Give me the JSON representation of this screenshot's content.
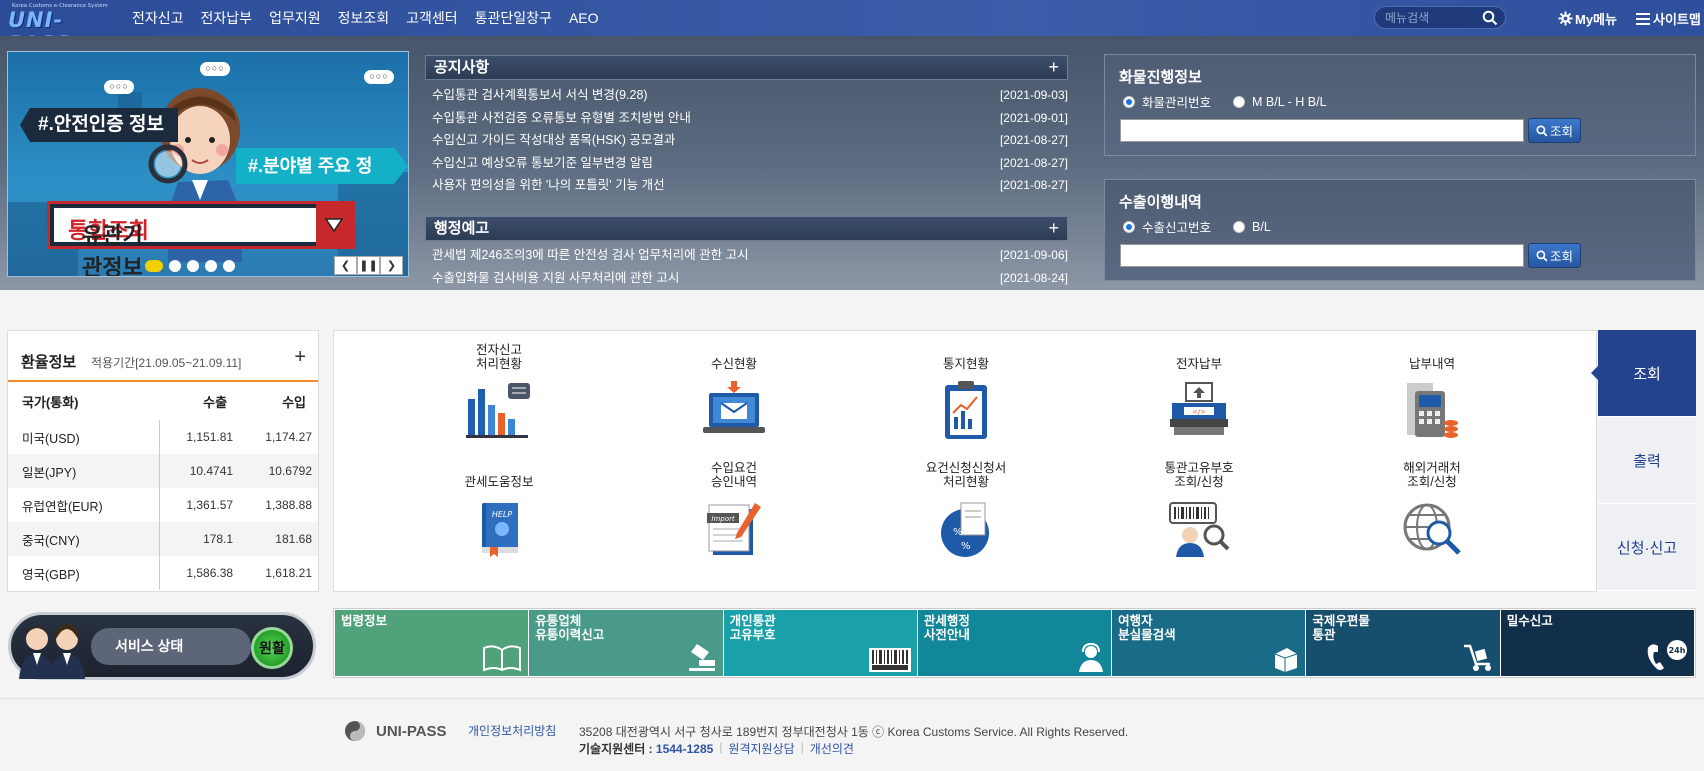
{
  "header": {
    "logo_sub": "Korea Customs e-Clearance System",
    "logo_main": "UNI-PASS",
    "nav": [
      "전자신고",
      "전자납부",
      "업무지원",
      "정보조회",
      "고객센터",
      "통관단일창구",
      "AEO"
    ],
    "search_placeholder": "메뉴검색",
    "my_menu": "My메뉴",
    "sitemap": "사이트맵"
  },
  "banner": {
    "tag_left": "#.안전인증 정보",
    "tag_right": "#.분야별 주요 정보",
    "box_text_1": "유관기관정보 ",
    "box_text_2": "통합조회",
    "dot_count": 5,
    "active_dot": 0
  },
  "notices": {
    "title": "공지사항",
    "items": [
      {
        "text": "수입통관 검사계획통보서 서식 변경(9.28)",
        "date": "[2021-09-03]"
      },
      {
        "text": "수입통관 사전검증 오류통보 유형별 조치방법 안내",
        "date": "[2021-09-01]"
      },
      {
        "text": "수입신고 가이드 작성대상 품목(HSK) 공모결과",
        "date": "[2021-08-27]"
      },
      {
        "text": "수입신고 예상오류 통보기준 일부변경 알림",
        "date": "[2021-08-27]"
      },
      {
        "text": "사용자 편의성을 위한 '나의 포틀릿' 기능 개선",
        "date": "[2021-08-27]"
      }
    ]
  },
  "admin_notice": {
    "title": "행정예고",
    "items": [
      {
        "text": "관세법 제246조의3에 따른 안전성 검사 업무처리에 관한 고시",
        "date": "[2021-09-06]"
      },
      {
        "text": "수출입화물 검사비용 지원 사무처리에 관한 고시",
        "date": "[2021-08-24]"
      }
    ]
  },
  "cargo": {
    "title": "화물진행정보",
    "radio1": "화물관리번호",
    "radio2": "M B/L - H B/L",
    "button": "조회"
  },
  "export": {
    "title": "수출이행내역",
    "radio1": "수출신고번호",
    "radio2": "B/L",
    "button": "조회"
  },
  "fx": {
    "title": "환율정보",
    "period": "적용기간[21.09.05~21.09.11]",
    "headers": [
      "국가(통화)",
      "수출",
      "수입"
    ],
    "rows": [
      {
        "country": "미국(USD)",
        "export": "1,151.81",
        "import": "1,174.27"
      },
      {
        "country": "일본(JPY)",
        "export": "10.4741",
        "import": "10.6792"
      },
      {
        "country": "유럽연합(EUR)",
        "export": "1,361.57",
        "import": "1,388.88"
      },
      {
        "country": "중국(CNY)",
        "export": "178.1",
        "import": "181.68"
      },
      {
        "country": "영국(GBP)",
        "export": "1,586.38",
        "import": "1,618.21"
      }
    ]
  },
  "service_status": {
    "label": "서비스 상태",
    "value": "원활"
  },
  "services": [
    {
      "label": "전자신고\n처리현황",
      "icon": "bar-chart-icon"
    },
    {
      "label": "수신현황",
      "icon": "laptop-mail-icon"
    },
    {
      "label": "통지현황",
      "icon": "clipboard-chart-icon"
    },
    {
      "label": "전자납부",
      "icon": "payment-terminal-icon"
    },
    {
      "label": "납부내역",
      "icon": "receipt-calculator-icon"
    },
    {
      "label": "관세도움정보",
      "icon": "help-book-icon"
    },
    {
      "label": "수입요건\n승인내역",
      "icon": "import-document-icon"
    },
    {
      "label": "요건신청신청서\n처리현황",
      "icon": "percent-document-icon"
    },
    {
      "label": "통관고유부호\n조회/신청",
      "icon": "barcode-search-icon"
    },
    {
      "label": "해외거래처\n조회/신청",
      "icon": "globe-search-icon"
    }
  ],
  "side_tabs": [
    "조회",
    "출력",
    "신청·신고"
  ],
  "quick_links": [
    {
      "label": "법령정보",
      "color": "#4fa27a",
      "icon": "book-icon"
    },
    {
      "label": "유통업체\n유통이력신고",
      "color": "#4a9a8a",
      "icon": "stamp-icon"
    },
    {
      "label": "개인통관\n고유부호",
      "color": "#1aa0a8",
      "icon": "barcode-icon"
    },
    {
      "label": "관세행정\n사전안내",
      "color": "#13879a",
      "icon": "headset-icon"
    },
    {
      "label": "여행자\n분실물검색",
      "color": "#1a6b87",
      "icon": "luggage-icon"
    },
    {
      "label": "국제우편물\n통관",
      "color": "#164f6e",
      "icon": "cart-icon"
    },
    {
      "label": "밀수신고",
      "color": "#112f4a",
      "icon": "phone-24h-icon"
    }
  ],
  "footer": {
    "brand": "UNI-PASS",
    "privacy": "개인정보처리방침",
    "address": "35208 대전광역시 서구 청사로 189번지 정부대전청사 1동 ⓒ Korea Customs Service. All Rights Reserved.",
    "tech_center_label": "기술지원센터 : ",
    "tech_center_phone": "1544-1285",
    "remote_support": "원격지원상담",
    "feedback": "개선의견"
  }
}
